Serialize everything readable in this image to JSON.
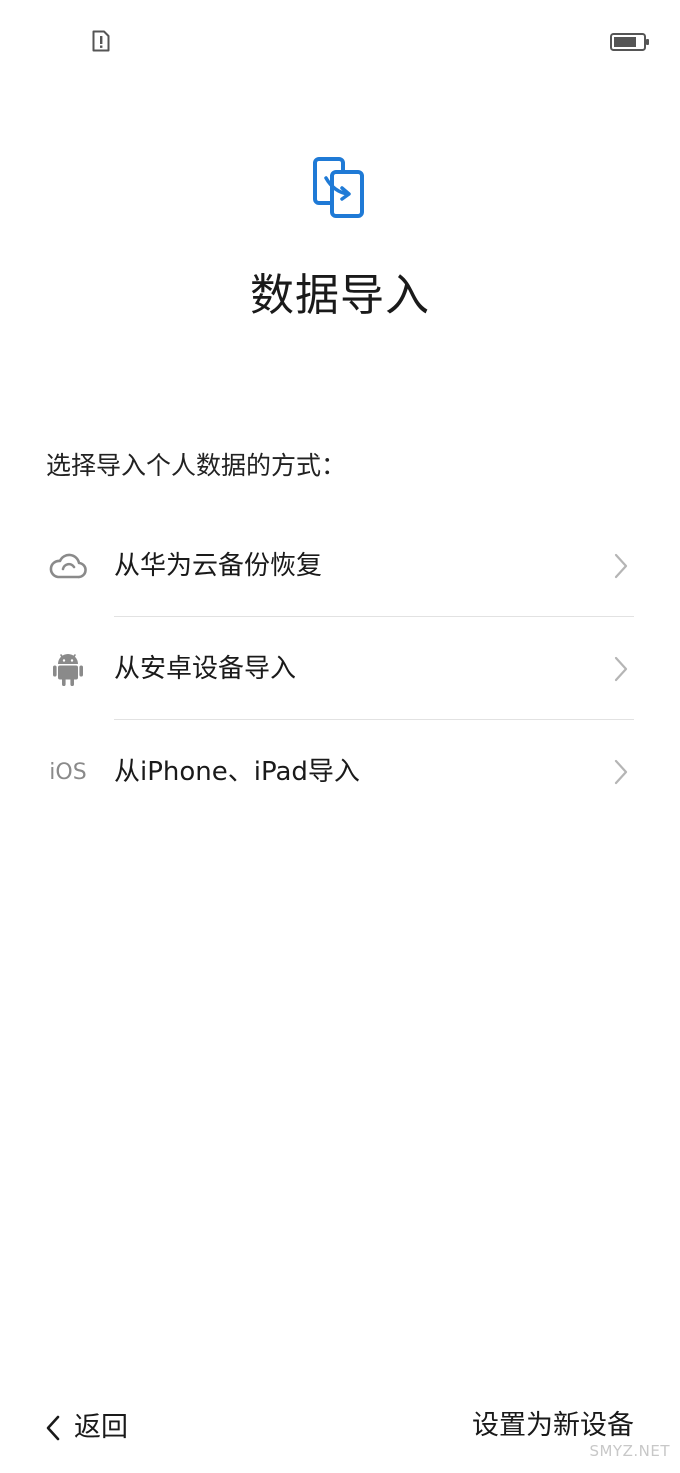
{
  "status_bar": {
    "sim_icon": "sim-alert-icon",
    "battery_icon": "battery-icon"
  },
  "header": {
    "icon": "phone-clone-icon",
    "title": "数据导入"
  },
  "section_label": "选择导入个人数据的方式：",
  "options": [
    {
      "icon": "cloud-icon",
      "label": "从华为云备份恢复"
    },
    {
      "icon": "android-icon",
      "label": "从安卓设备导入"
    },
    {
      "icon": "ios-icon",
      "icon_text": "iOS",
      "label": "从iPhone、iPad导入"
    }
  ],
  "footer": {
    "back_label": "返回",
    "new_device_label": "设置为新设备"
  },
  "watermark": "SMYZ.NET",
  "colors": {
    "accent": "#1f7ad6",
    "icon_gray": "#8a8a8a",
    "divider": "#e2e2e2"
  }
}
